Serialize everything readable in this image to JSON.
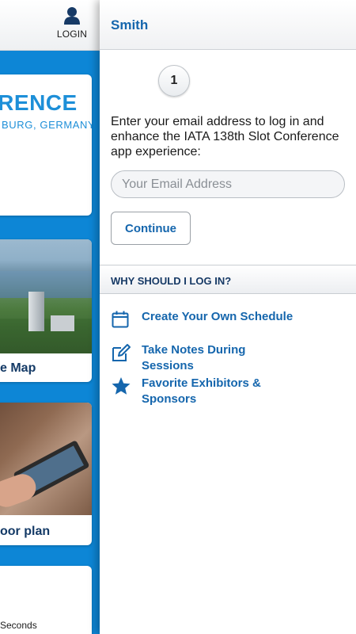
{
  "background_app": {
    "login_label": "LOGIN",
    "cards": [
      {
        "logo_text": "ERENCE",
        "logo_subtext": "BURG, GERMANY"
      },
      {
        "caption": "e Map"
      },
      {
        "caption": "oor plan"
      },
      {
        "text": "Seconds"
      }
    ]
  },
  "panel": {
    "title": "Smith",
    "step_number": "1",
    "intro_text": "Enter your email address to log in and enhance the IATA 138th Slot Conference app experience:",
    "email": {
      "placeholder": "Your Email Address",
      "value": ""
    },
    "continue_label": "Continue",
    "why_heading": "WHY SHOULD I LOG IN?",
    "benefits": [
      {
        "icon": "calendar-icon",
        "label": "Create Your Own Schedule"
      },
      {
        "icon": "edit-note-icon",
        "label": "Take Notes During Sessions"
      },
      {
        "icon": "star-icon",
        "label": "Favorite Exhibitors & Sponsors"
      }
    ]
  },
  "colors": {
    "accent_blue": "#1566ad",
    "background_blue": "#0d86d6",
    "heading_navy": "#173a66"
  }
}
